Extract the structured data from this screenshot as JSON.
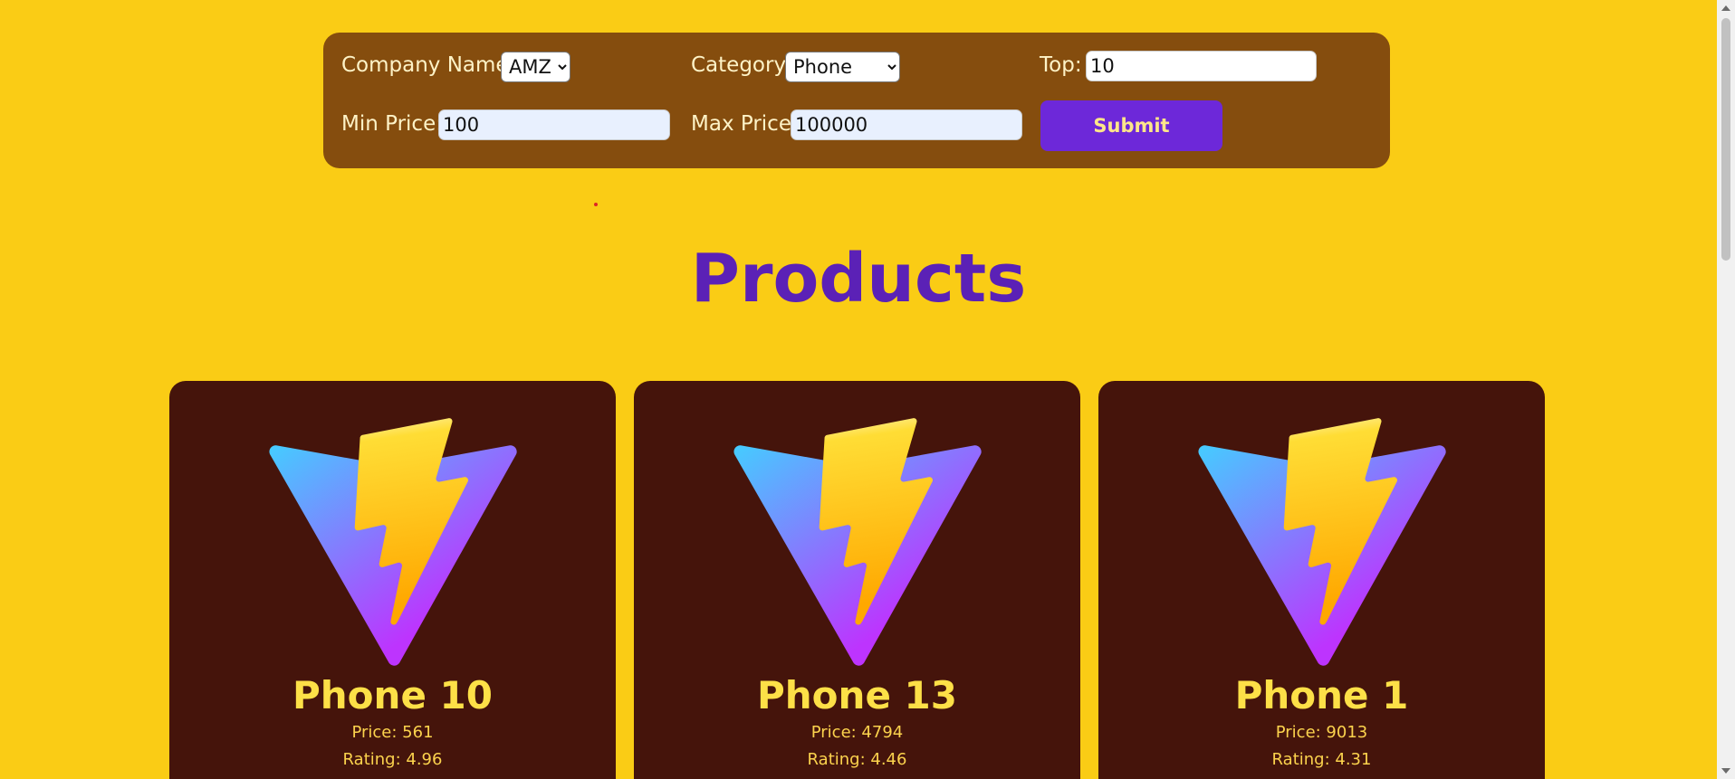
{
  "filters": {
    "company_label": "Company Name:",
    "company_value": "AMZ",
    "category_label": "Category:",
    "category_value": "Phone",
    "top_label": "Top:",
    "top_value": "10",
    "min_price_label": "Min Price:",
    "min_price_value": "100",
    "max_price_label": "Max Price:",
    "max_price_value": "100000",
    "submit_label": "Submit"
  },
  "page_title": "Products",
  "products": [
    {
      "name": "Phone 10",
      "price": "Price: 561",
      "rating": "Rating: 4.96"
    },
    {
      "name": "Phone 13",
      "price": "Price: 4794",
      "rating": "Rating: 4.46"
    },
    {
      "name": "Phone 1",
      "price": "Price: 9013",
      "rating": "Rating: 4.31"
    }
  ],
  "colors": {
    "background": "#facc15",
    "form_background": "#854d0e",
    "submit_button": "#6d28d9",
    "title": "#5b21b6",
    "card_background": "#45140b",
    "card_title": "#fde047"
  },
  "icons": {
    "product_image": "vite-logo-icon"
  }
}
